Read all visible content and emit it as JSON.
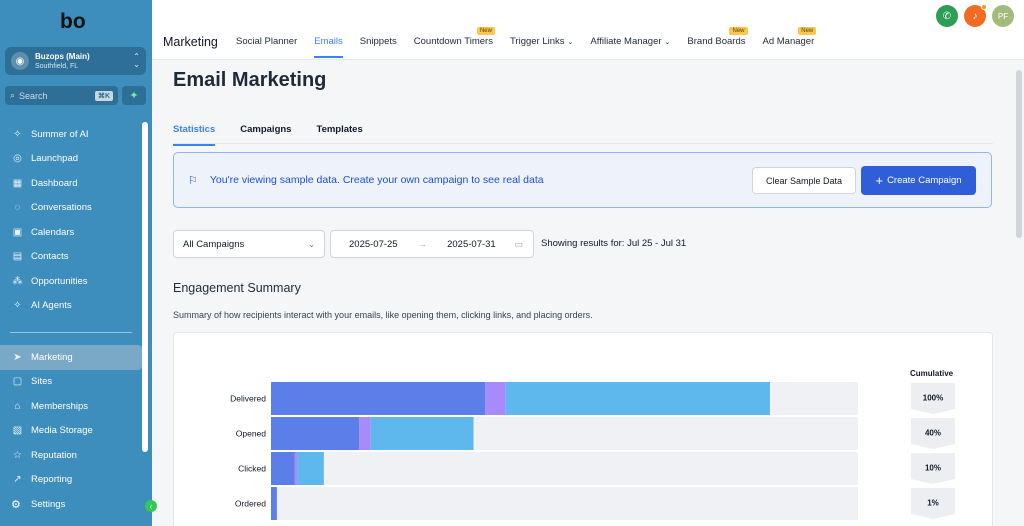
{
  "app": {
    "logo_text": "bo"
  },
  "account": {
    "name": "Buzops (Main)",
    "location": "Southfield, FL"
  },
  "search": {
    "placeholder": "Search",
    "shortcut": "⌘K"
  },
  "sidebar": {
    "items": [
      {
        "label": "Summer of AI",
        "icon": "sparkle-icon"
      },
      {
        "label": "Launchpad",
        "icon": "rocket-icon"
      },
      {
        "label": "Dashboard",
        "icon": "grid-icon"
      },
      {
        "label": "Conversations",
        "icon": "chat-icon"
      },
      {
        "label": "Calendars",
        "icon": "calendar-icon"
      },
      {
        "label": "Contacts",
        "icon": "contacts-icon"
      },
      {
        "label": "Opportunities",
        "icon": "network-icon"
      },
      {
        "label": "AI Agents",
        "icon": "sparkle-icon"
      }
    ],
    "items2": [
      {
        "label": "Marketing",
        "icon": "send-icon"
      },
      {
        "label": "Sites",
        "icon": "sites-icon"
      },
      {
        "label": "Memberships",
        "icon": "membership-icon"
      },
      {
        "label": "Media Storage",
        "icon": "media-icon"
      },
      {
        "label": "Reputation",
        "icon": "star-icon"
      },
      {
        "label": "Reporting",
        "icon": "trend-icon"
      }
    ],
    "settings_label": "Settings"
  },
  "topbar": {
    "module": "Marketing",
    "tabs": [
      {
        "label": "Social Planner",
        "new": false,
        "dropdown": false
      },
      {
        "label": "Emails",
        "new": false,
        "dropdown": false,
        "active": true
      },
      {
        "label": "Snippets",
        "new": false,
        "dropdown": false
      },
      {
        "label": "Countdown Timers",
        "new": true,
        "dropdown": false
      },
      {
        "label": "Trigger Links",
        "new": false,
        "dropdown": true
      },
      {
        "label": "Affiliate Manager",
        "new": false,
        "dropdown": true
      },
      {
        "label": "Brand Boards",
        "new": true,
        "dropdown": false
      },
      {
        "label": "Ad Manager",
        "new": true,
        "dropdown": false
      }
    ],
    "new_badge": "New",
    "user_initials": "PF"
  },
  "page": {
    "title": "Email Marketing",
    "subtabs": [
      "Statistics",
      "Campaigns",
      "Templates"
    ],
    "banner": {
      "message": "You're viewing sample data. Create your own campaign to see real data",
      "clear_label": "Clear Sample Data",
      "create_label": "Create Campaign"
    },
    "filters": {
      "campaign": "All Campaigns",
      "start_date": "2025-07-25",
      "end_date": "2025-07-31",
      "results": "Showing results for: Jul 25 - Jul 31"
    },
    "engagement": {
      "title": "Engagement Summary",
      "description": "Summary of how recipients interact with your emails, like opening them, clicking links, and placing orders.",
      "cumulative_label": "Cumulative"
    }
  },
  "colors": {
    "sidebar": "#3d8dbd",
    "primary": "#2f5ed8",
    "seg1": "#5b7ee8",
    "seg2": "#a78bfa",
    "seg3": "#5eb8ee",
    "track": "#f0f1f4"
  },
  "chart_data": {
    "type": "bar",
    "categories": [
      "Delivered",
      "Opened",
      "Clicked",
      "Ordered"
    ],
    "series": [
      {
        "values": [
          36.5,
          15,
          4,
          1
        ]
      },
      {
        "values": [
          3.5,
          2,
          0.5,
          0
        ]
      },
      {
        "values": [
          45,
          17.5,
          4.5,
          0
        ]
      }
    ],
    "cumulative": [
      "100%",
      "40%",
      "10%",
      "1%"
    ],
    "xlim": [
      0,
      100
    ]
  }
}
